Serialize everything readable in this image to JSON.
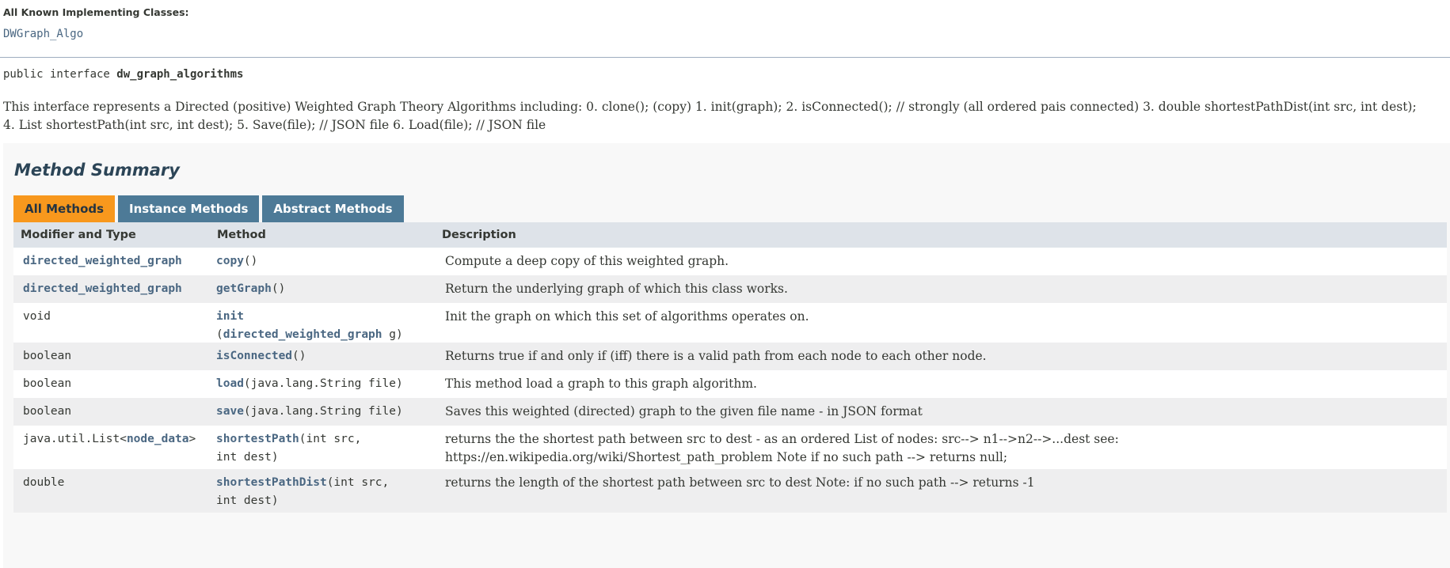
{
  "implementing": {
    "label": "All Known Implementing Classes:",
    "class_link": "DWGraph_Algo"
  },
  "signature": {
    "prefix": "public interface ",
    "name": "dw_graph_algorithms"
  },
  "description": "This interface represents a Directed (positive) Weighted Graph Theory Algorithms including: 0. clone(); (copy) 1. init(graph); 2. isConnected(); // strongly (all ordered pais connected) 3. double shortestPathDist(int src, int dest); 4. List shortestPath(int src, int dest); 5. Save(file); // JSON file 6. Load(file); // JSON file",
  "summary": {
    "title": "Method Summary",
    "tabs": [
      "All Methods",
      "Instance Methods",
      "Abstract Methods"
    ],
    "active_tab": "All Methods",
    "headers": [
      "Modifier and Type",
      "Method",
      "Description"
    ],
    "rows": [
      {
        "type_link": "directed_weighted_graph",
        "method_name": "copy",
        "method_params": "()",
        "description": "Compute a deep copy of this weighted graph."
      },
      {
        "type_link": "directed_weighted_graph",
        "method_name": "getGraph",
        "method_params": "()",
        "description": "Return the underlying graph of which this class works."
      },
      {
        "type": "void",
        "method_name": "init",
        "method_params_open": "(",
        "method_params_link": "directed_weighted_graph",
        "method_params_close": " g)",
        "description": "Init the graph on which this set of algorithms operates on."
      },
      {
        "type": "boolean",
        "method_name": "isConnected",
        "method_params": "()",
        "description": "Returns true if and only if (iff) there is a valid path from each node to each other node."
      },
      {
        "type": "boolean",
        "method_name": "load",
        "method_params": "(java.lang.String file)",
        "description": "This method load a graph to this graph algorithm."
      },
      {
        "type": "boolean",
        "method_name": "save",
        "method_params": "(java.lang.String file)",
        "description": "Saves this weighted (directed) graph to the given file name - in JSON format"
      },
      {
        "type_prefix": "java.util.List<",
        "type_link": "node_data",
        "type_suffix": ">",
        "method_name": "shortestPath",
        "method_params_line1": "(int src,",
        "method_params_line2": "int dest)",
        "description": "returns the the shortest path between src to dest - as an ordered List of nodes: src--> n1-->n2-->...dest see: https://en.wikipedia.org/wiki/Shortest_path_problem Note if no such path --> returns null;"
      },
      {
        "type": "double",
        "method_name": "shortestPathDist",
        "method_params_line1": "(int src,",
        "method_params_line2": "int dest)",
        "description": "returns the length of the shortest path between src to dest Note: if no such path --> returns -1"
      }
    ]
  },
  "colors": {
    "link": "#4a6782",
    "tab_active": "#f8981d",
    "tab_inactive": "#4d7a97",
    "header_bg": "#dee3e9",
    "row_alt_bg": "#eeeeef"
  }
}
